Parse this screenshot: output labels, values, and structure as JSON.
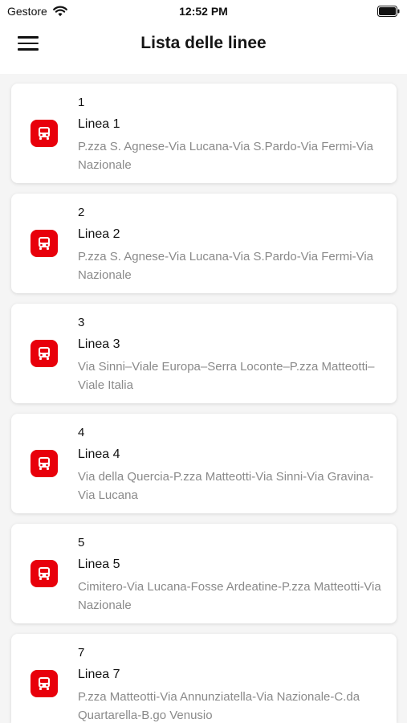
{
  "status_bar": {
    "carrier": "Gestore",
    "time": "12:52 PM"
  },
  "header": {
    "title": "Lista delle linee",
    "menu_icon": "hamburger-menu-icon"
  },
  "lines": [
    {
      "code": "1",
      "name": "Linea 1",
      "route": "P.zza S. Agnese-Via Lucana-Via S.Pardo-Via Fermi-Via Nazionale",
      "icon": "bus-icon"
    },
    {
      "code": "2",
      "name": "Linea 2",
      "route": "P.zza S. Agnese-Via Lucana-Via S.Pardo-Via Fermi-Via Nazionale",
      "icon": "bus-icon"
    },
    {
      "code": "3",
      "name": "Linea 3",
      "route": "Via Sinni–Viale Europa–Serra Loconte–P.zza Matteotti–Viale Italia",
      "icon": "bus-icon"
    },
    {
      "code": "4",
      "name": "Linea 4",
      "route": "Via della Quercia-P.zza Matteotti-Via Sinni-Via Gravina-Via Lucana",
      "icon": "bus-icon"
    },
    {
      "code": "5",
      "name": "Linea 5",
      "route": "Cimitero-Via Lucana-Fosse Ardeatine-P.zza Matteotti-Via Nazionale",
      "icon": "bus-icon"
    },
    {
      "code": "7",
      "name": "Linea 7",
      "route": "P.zza Matteotti-Via Annunziatella-Via Nazionale-C.da Quartarella-B.go Venusio",
      "icon": "bus-icon"
    }
  ],
  "colors": {
    "accent": "#e8000b",
    "background": "#f5f5f5",
    "card": "#ffffff",
    "secondary_text": "#8a8a8a"
  }
}
